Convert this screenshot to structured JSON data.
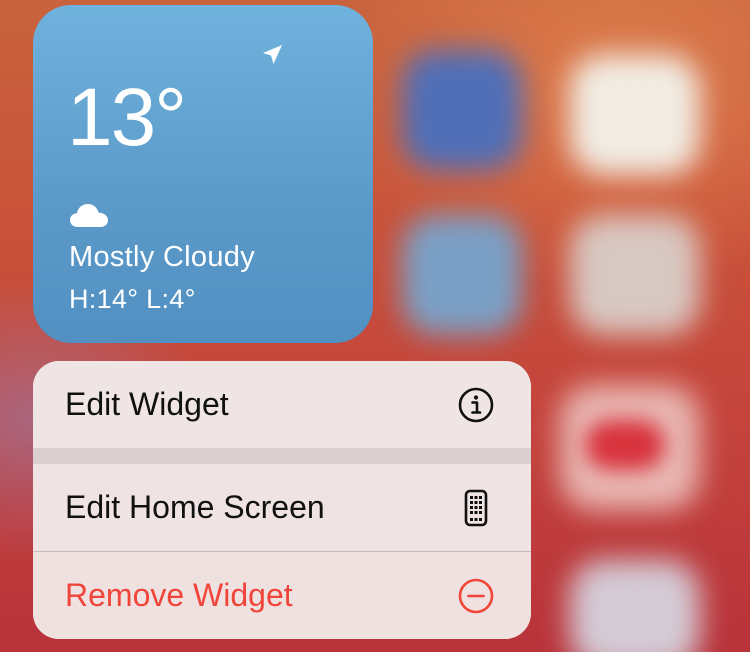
{
  "widget": {
    "temperature": "13°",
    "condition": "Mostly Cloudy",
    "high_low": "H:14° L:4°",
    "icons": [
      "location-arrow-icon",
      "cloud-icon"
    ]
  },
  "context_menu": {
    "items": [
      {
        "label": "Edit Widget",
        "icon": "info-circle-icon"
      },
      {
        "label": "Edit Home Screen",
        "icon": "phone-icon"
      },
      {
        "label": "Remove Widget",
        "icon": "minus-circle-icon",
        "destructive": true
      }
    ]
  },
  "colors": {
    "widget_blue": "#5b99c8",
    "destructive_red": "#f0453a",
    "menu_background": "#efe4e4",
    "wallpaper_red": "#c4433c"
  }
}
